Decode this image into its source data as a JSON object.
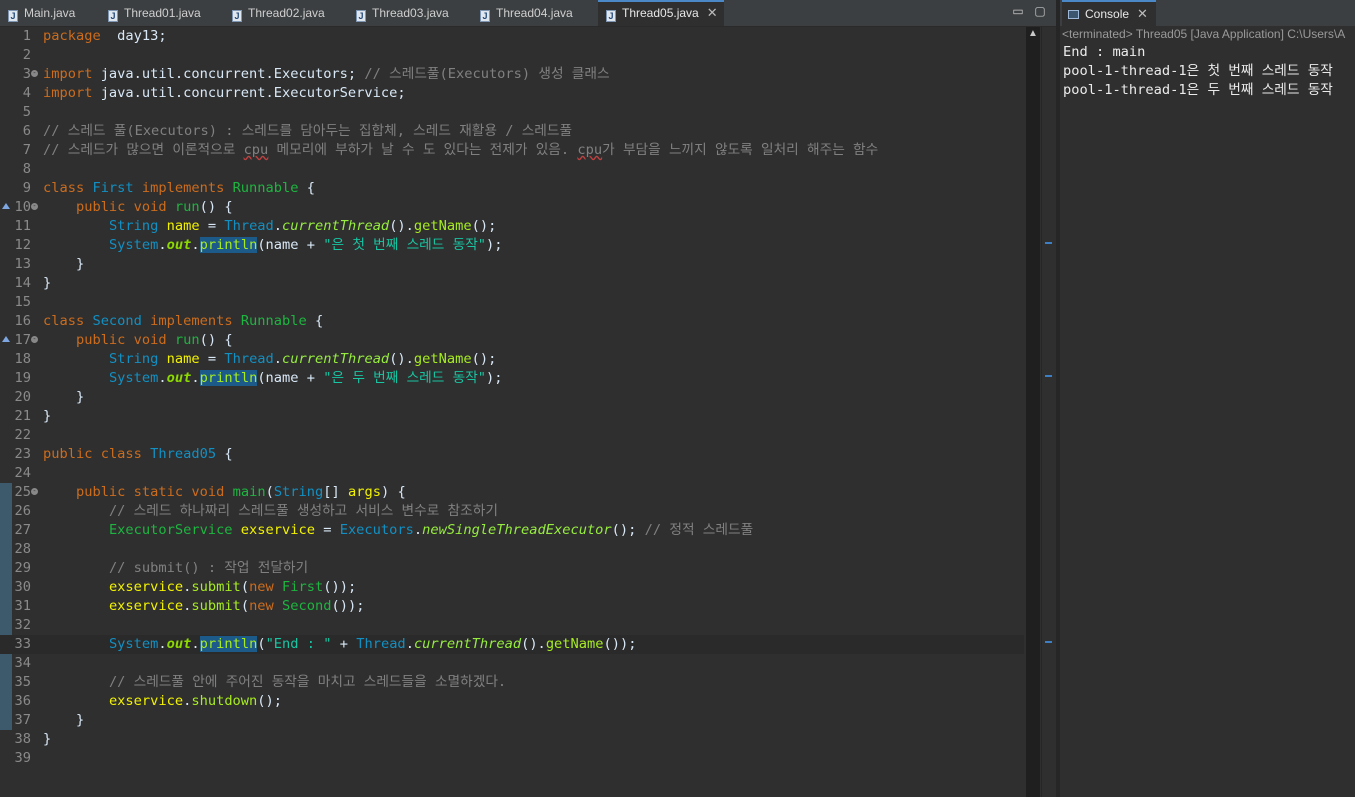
{
  "editor": {
    "tabs": [
      {
        "label": "Main.java",
        "active": false
      },
      {
        "label": "Thread01.java",
        "active": false
      },
      {
        "label": "Thread02.java",
        "active": false
      },
      {
        "label": "Thread03.java",
        "active": false
      },
      {
        "label": "Thread04.java",
        "active": false
      },
      {
        "label": "Thread05.java",
        "active": true
      }
    ],
    "minimize_label": "▭",
    "maximize_label": "▢",
    "lines": [
      {
        "n": "1",
        "segs": [
          [
            "kw",
            "package"
          ],
          [
            "",
            "  day13;"
          ]
        ]
      },
      {
        "n": "2",
        "segs": []
      },
      {
        "n": "3",
        "fold": true,
        "segs": [
          [
            "kw",
            "import"
          ],
          [
            "",
            " java.util.concurrent.Executors; "
          ],
          [
            "cm",
            "// 스레드풀(Executors) 생성 클래스"
          ]
        ]
      },
      {
        "n": "4",
        "segs": [
          [
            "kw",
            "import"
          ],
          [
            "",
            " java.util.concurrent.ExecutorService;"
          ]
        ]
      },
      {
        "n": "5",
        "segs": []
      },
      {
        "n": "6",
        "segs": [
          [
            "cm",
            "// 스레드 풀(Executors) : 스레드를 담아두는 집합체, 스레드 재활용 / 스레드풀"
          ]
        ]
      },
      {
        "n": "7",
        "segs": [
          [
            "cm",
            "// 스레드가 많으면 이론적으로 "
          ],
          [
            "cm squig",
            "cpu"
          ],
          [
            "cm",
            " 메모리에 부하가 날 수 도 있다는 전제가 있음. "
          ],
          [
            "cm squig",
            "cpu"
          ],
          [
            "cm",
            "가 부담을 느끼지 않도록 일처리 해주는 함수"
          ]
        ]
      },
      {
        "n": "8",
        "segs": []
      },
      {
        "n": "9",
        "segs": [
          [
            "kw",
            "class"
          ],
          [
            "",
            " "
          ],
          [
            "cls",
            "First"
          ],
          [
            "",
            " "
          ],
          [
            "kw",
            "implements"
          ],
          [
            "",
            " "
          ],
          [
            "fn",
            "Runnable"
          ],
          [
            "",
            " {"
          ]
        ]
      },
      {
        "n": "10",
        "fold": true,
        "ovr": true,
        "segs": [
          [
            "",
            "    "
          ],
          [
            "kw",
            "public"
          ],
          [
            "",
            " "
          ],
          [
            "kw",
            "void"
          ],
          [
            "",
            " "
          ],
          [
            "fn",
            "run"
          ],
          [
            "",
            "() {"
          ]
        ]
      },
      {
        "n": "11",
        "segs": [
          [
            "",
            "        "
          ],
          [
            "cls",
            "String"
          ],
          [
            "",
            " "
          ],
          [
            "var",
            "name"
          ],
          [
            "",
            " = "
          ],
          [
            "cls",
            "Thread"
          ],
          [
            "",
            "."
          ],
          [
            "st",
            "currentThread"
          ],
          [
            "",
            "()."
          ],
          [
            "mth",
            "getName"
          ],
          [
            "",
            "();"
          ]
        ]
      },
      {
        "n": "12",
        "segs": [
          [
            "",
            "        "
          ],
          [
            "cls",
            "System"
          ],
          [
            "",
            "."
          ],
          [
            "fld",
            "out"
          ],
          [
            "",
            "."
          ],
          [
            "mth hl",
            "println"
          ],
          [
            "",
            "(name + "
          ],
          [
            "str",
            "\"은 첫 번째 스레드 동작\""
          ],
          [
            "",
            ");"
          ]
        ]
      },
      {
        "n": "13",
        "segs": [
          [
            "",
            "    }"
          ]
        ]
      },
      {
        "n": "14",
        "segs": [
          [
            "",
            "}"
          ]
        ]
      },
      {
        "n": "15",
        "segs": []
      },
      {
        "n": "16",
        "segs": [
          [
            "kw",
            "class"
          ],
          [
            "",
            " "
          ],
          [
            "cls",
            "Second"
          ],
          [
            "",
            " "
          ],
          [
            "kw",
            "implements"
          ],
          [
            "",
            " "
          ],
          [
            "fn",
            "Runnable"
          ],
          [
            "",
            " {"
          ]
        ]
      },
      {
        "n": "17",
        "fold": true,
        "ovr": true,
        "segs": [
          [
            "",
            "    "
          ],
          [
            "kw",
            "public"
          ],
          [
            "",
            " "
          ],
          [
            "kw",
            "void"
          ],
          [
            "",
            " "
          ],
          [
            "fn",
            "run"
          ],
          [
            "",
            "() {"
          ]
        ]
      },
      {
        "n": "18",
        "segs": [
          [
            "",
            "        "
          ],
          [
            "cls",
            "String"
          ],
          [
            "",
            " "
          ],
          [
            "var",
            "name"
          ],
          [
            "",
            " = "
          ],
          [
            "cls",
            "Thread"
          ],
          [
            "",
            "."
          ],
          [
            "st",
            "currentThread"
          ],
          [
            "",
            "()."
          ],
          [
            "mth",
            "getName"
          ],
          [
            "",
            "();"
          ]
        ]
      },
      {
        "n": "19",
        "segs": [
          [
            "",
            "        "
          ],
          [
            "cls",
            "System"
          ],
          [
            "",
            "."
          ],
          [
            "fld",
            "out"
          ],
          [
            "",
            "."
          ],
          [
            "mth hl",
            "println"
          ],
          [
            "",
            "(name + "
          ],
          [
            "str",
            "\"은 두 번째 스레드 동작\""
          ],
          [
            "",
            ");"
          ]
        ]
      },
      {
        "n": "20",
        "segs": [
          [
            "",
            "    }"
          ]
        ]
      },
      {
        "n": "21",
        "segs": [
          [
            "",
            "}"
          ]
        ]
      },
      {
        "n": "22",
        "segs": []
      },
      {
        "n": "23",
        "segs": [
          [
            "kw",
            "public"
          ],
          [
            "",
            " "
          ],
          [
            "kw",
            "class"
          ],
          [
            "",
            " "
          ],
          [
            "cls",
            "Thread05"
          ],
          [
            "",
            " {"
          ]
        ]
      },
      {
        "n": "24",
        "segs": []
      },
      {
        "n": "25",
        "fold": true,
        "segs": [
          [
            "",
            "    "
          ],
          [
            "kw",
            "public"
          ],
          [
            "",
            " "
          ],
          [
            "kw",
            "static"
          ],
          [
            "",
            " "
          ],
          [
            "kw",
            "void"
          ],
          [
            "",
            " "
          ],
          [
            "fn",
            "main"
          ],
          [
            "",
            "("
          ],
          [
            "cls",
            "String"
          ],
          [
            "",
            "[] "
          ],
          [
            "var",
            "args"
          ],
          [
            "",
            ") {"
          ]
        ]
      },
      {
        "n": "26",
        "segs": [
          [
            "",
            "        "
          ],
          [
            "cm",
            "// 스레드 하나짜리 스레드풀 생성하고 서비스 변수로 참조하기"
          ]
        ]
      },
      {
        "n": "27",
        "segs": [
          [
            "",
            "        "
          ],
          [
            "fn",
            "ExecutorService"
          ],
          [
            "",
            " "
          ],
          [
            "var",
            "exservice"
          ],
          [
            "",
            " = "
          ],
          [
            "cls",
            "Executors"
          ],
          [
            "",
            "."
          ],
          [
            "st",
            "newSingleThreadExecutor"
          ],
          [
            "",
            "(); "
          ],
          [
            "cm",
            "// 정적 스레드풀"
          ]
        ]
      },
      {
        "n": "28",
        "segs": []
      },
      {
        "n": "29",
        "segs": [
          [
            "",
            "        "
          ],
          [
            "cm",
            "// submit() : 작업 전달하기"
          ]
        ]
      },
      {
        "n": "30",
        "segs": [
          [
            "",
            "        "
          ],
          [
            "var",
            "exservice"
          ],
          [
            "",
            "."
          ],
          [
            "mth",
            "submit"
          ],
          [
            "",
            "("
          ],
          [
            "kw",
            "new"
          ],
          [
            "",
            " "
          ],
          [
            "fn",
            "First"
          ],
          [
            "",
            "());"
          ]
        ]
      },
      {
        "n": "31",
        "segs": [
          [
            "",
            "        "
          ],
          [
            "var",
            "exservice"
          ],
          [
            "",
            "."
          ],
          [
            "mth",
            "submit"
          ],
          [
            "",
            "("
          ],
          [
            "kw",
            "new"
          ],
          [
            "",
            " "
          ],
          [
            "fn",
            "Second"
          ],
          [
            "",
            "());"
          ]
        ]
      },
      {
        "n": "32",
        "segs": []
      },
      {
        "n": "33",
        "current": true,
        "segs": [
          [
            "",
            "        "
          ],
          [
            "cls",
            "System"
          ],
          [
            "",
            "."
          ],
          [
            "fld",
            "out"
          ],
          [
            "",
            "."
          ],
          [
            "mth hl",
            "println"
          ],
          [
            "",
            "("
          ],
          [
            "str",
            "\"End : \""
          ],
          [
            "",
            " + "
          ],
          [
            "cls",
            "Thread"
          ],
          [
            "",
            "."
          ],
          [
            "st",
            "currentThread"
          ],
          [
            "",
            "()."
          ],
          [
            "mth",
            "getName"
          ],
          [
            "",
            "());"
          ]
        ]
      },
      {
        "n": "34",
        "segs": []
      },
      {
        "n": "35",
        "segs": [
          [
            "",
            "        "
          ],
          [
            "cm",
            "// 스레드풀 안에 주어진 동작을 마치고 스레드들을 소멸하겠다."
          ]
        ]
      },
      {
        "n": "36",
        "segs": [
          [
            "",
            "        "
          ],
          [
            "var",
            "exservice"
          ],
          [
            "",
            "."
          ],
          [
            "mth",
            "shutdown"
          ],
          [
            "",
            "();"
          ]
        ]
      },
      {
        "n": "37",
        "segs": [
          [
            "",
            "    }"
          ]
        ]
      },
      {
        "n": "38",
        "segs": [
          [
            "",
            "}"
          ]
        ]
      },
      {
        "n": "39",
        "segs": []
      }
    ]
  },
  "console": {
    "tab_label": "Console",
    "status": "<terminated> Thread05 [Java Application] C:\\Users\\A",
    "output": [
      "End : main",
      "pool-1-thread-1은 첫 번째 스레드 동작",
      "pool-1-thread-1은 두 번째 스레드 동작"
    ]
  },
  "colors": {
    "background": "#2f2f2f",
    "keyword": "#cc6c1d",
    "type": "#1290c3",
    "string": "#17c6a3",
    "comment": "#808080",
    "active_tab_accent": "#4a88c7"
  }
}
